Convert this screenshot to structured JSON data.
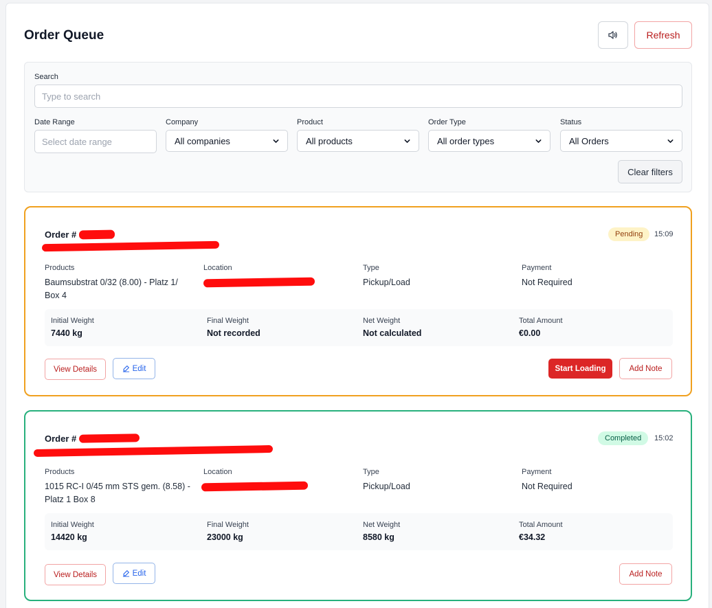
{
  "page": {
    "title": "Order Queue"
  },
  "toolbar": {
    "sound_icon": "speaker-icon",
    "refresh_label": "Refresh"
  },
  "filters": {
    "search_label": "Search",
    "search_placeholder": "Type to search",
    "date_label": "Date Range",
    "date_placeholder": "Select date range",
    "company_label": "Company",
    "company_value": "All companies",
    "product_label": "Product",
    "product_value": "All products",
    "order_type_label": "Order Type",
    "order_type_value": "All order types",
    "status_label": "Status",
    "status_value": "All Orders",
    "clear_label": "Clear filters"
  },
  "labels": {
    "products": "Products",
    "location": "Location",
    "type": "Type",
    "payment": "Payment",
    "initial_weight": "Initial Weight",
    "final_weight": "Final Weight",
    "net_weight": "Net Weight",
    "total_amount": "Total Amount",
    "view_details": "View Details",
    "edit": "Edit",
    "add_note": "Add Note",
    "start_loading": "Start Loading"
  },
  "orders": [
    {
      "order_prefix": "Order #",
      "status": "Pending",
      "time": "15:09",
      "products": "Baumsubstrat 0/32 (8.00) - Platz 1/ Box 4",
      "type": "Pickup/Load",
      "payment": "Not Required",
      "initial_weight": "7440 kg",
      "final_weight": "Not recorded",
      "net_weight": "Not calculated",
      "total_amount": "€0.00",
      "border_color": "#f0a01e"
    },
    {
      "order_prefix": "Order #",
      "status": "Completed",
      "time": "15:02",
      "products": "1015 RC-I 0/45 mm STS gem. (8.58) - Platz 1 Box 8",
      "type": "Pickup/Load",
      "payment": "Not Required",
      "initial_weight": "14420 kg",
      "final_weight": "23000 kg",
      "net_weight": "8580 kg",
      "total_amount": "€34.32",
      "border_color": "#27b07c"
    }
  ]
}
